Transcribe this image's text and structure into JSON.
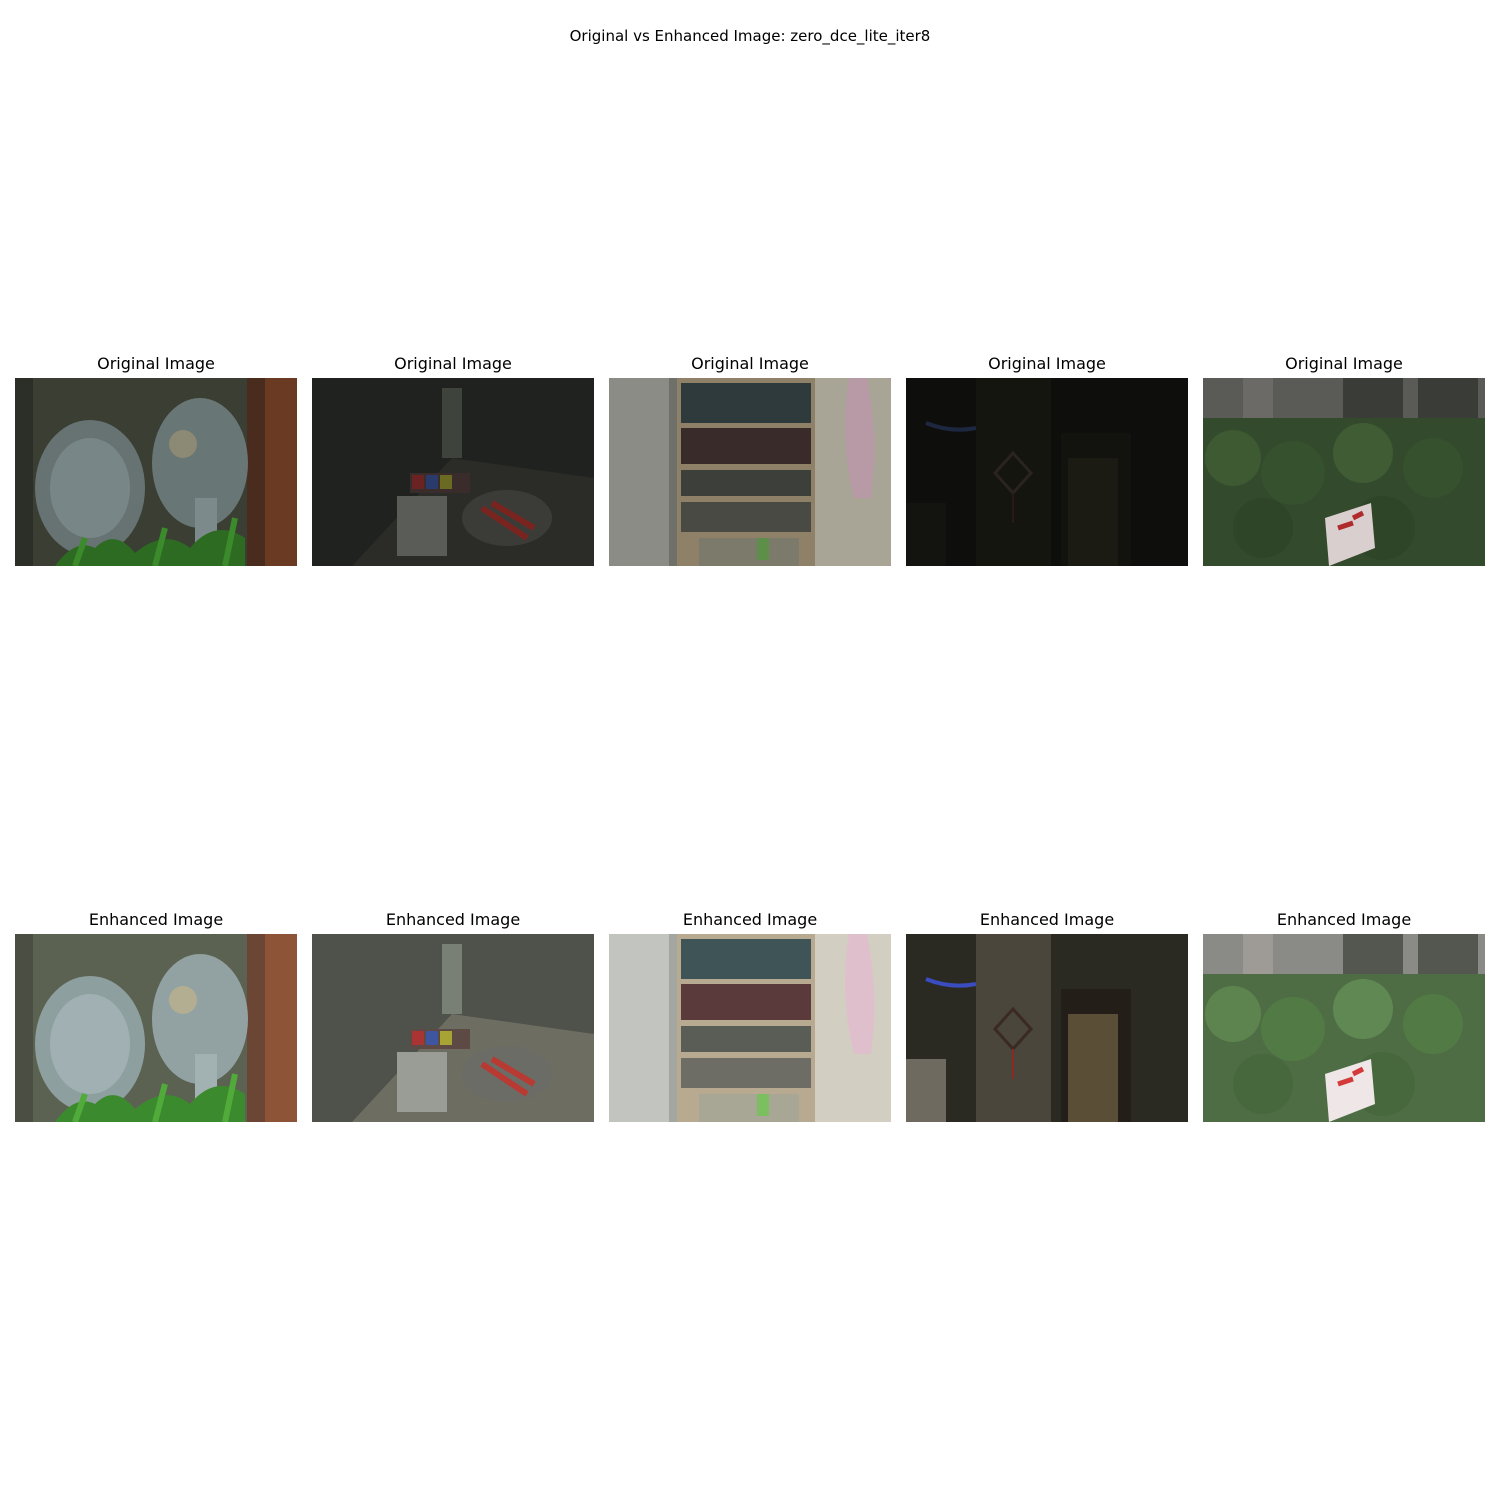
{
  "figure": {
    "suptitle": "Original vs Enhanced Image: zero_dce_lite_iter8"
  },
  "rows": [
    {
      "row_name": "original",
      "panels": [
        {
          "title": "Original Image",
          "scene": "fans"
        },
        {
          "title": "Original Image",
          "scene": "table"
        },
        {
          "title": "Original Image",
          "scene": "bookshelf"
        },
        {
          "title": "Original Image",
          "scene": "hallway"
        },
        {
          "title": "Original Image",
          "scene": "hedge"
        }
      ]
    },
    {
      "row_name": "enhanced",
      "panels": [
        {
          "title": "Enhanced Image",
          "scene": "fans"
        },
        {
          "title": "Enhanced Image",
          "scene": "table"
        },
        {
          "title": "Enhanced Image",
          "scene": "bookshelf"
        },
        {
          "title": "Enhanced Image",
          "scene": "hallway"
        },
        {
          "title": "Enhanced Image",
          "scene": "hedge"
        }
      ]
    }
  ]
}
